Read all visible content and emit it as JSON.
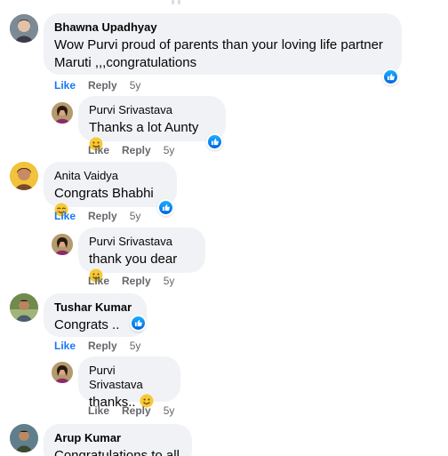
{
  "comments": [
    {
      "author": "Bhawna Upadhyay",
      "text": "Wow Purvi proud of parents than your loving life partner Maruti ,,,congratulations",
      "actions": {
        "like": "Like",
        "reply": "Reply",
        "time": "5y"
      }
    },
    {
      "author": "Purvi Srivastava",
      "text": "Thanks a lot Aunty",
      "emoji": "smiley-emoji",
      "actions": {
        "like": "Like",
        "reply": "Reply",
        "time": "5y"
      }
    },
    {
      "author": "Anita Vaidya",
      "text": "Congrats Bhabhi",
      "emoji": "smiling-emoji",
      "actions": {
        "like": "Like",
        "reply": "Reply",
        "time": "5y"
      }
    },
    {
      "author": "Purvi Srivastava",
      "text": "thank you dear",
      "emoji": "smiley-emoji",
      "actions": {
        "like": "Like",
        "reply": "Reply",
        "time": "5y"
      }
    },
    {
      "author": "Tushar Kumar",
      "text": "Congrats ..",
      "actions": {
        "like": "Like",
        "reply": "Reply",
        "time": "5y"
      }
    },
    {
      "author": "Purvi Srivastava",
      "text": "thanks..",
      "emoji": "smiley-emoji",
      "actions": {
        "like": "Like",
        "reply": "Reply",
        "time": "5y"
      }
    },
    {
      "author": "Arup Kumar",
      "text": "Congratulations to all"
    }
  ],
  "colors": {
    "bubble": "#f0f2f5",
    "like_blue": "#1877f2",
    "meta_gray": "#65676b"
  },
  "icons": [
    "like-reaction-icon",
    "smiley-emoji"
  ]
}
